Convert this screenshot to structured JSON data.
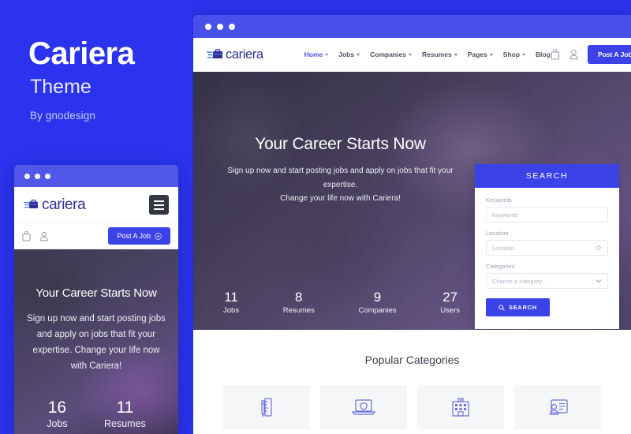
{
  "promo": {
    "title": "Cariera",
    "subtitle": "Theme",
    "byline": "By gnodesign",
    "background_color": "#2b33ee"
  },
  "mobile_mockup": {
    "chrome_dots": 3,
    "logo_text": "cariera",
    "menu_icon": "hamburger-icon",
    "toolbar_icons": [
      "bag-icon",
      "user-icon"
    ],
    "post_job_label": "Post A Job",
    "hero": {
      "title": "Your Career Starts Now",
      "subtitle": "Sign up now and start posting jobs and apply on jobs that fit your expertise. Change your life now with Cariera!",
      "stats": [
        {
          "value": "16",
          "label": "Jobs"
        },
        {
          "value": "11",
          "label": "Resumes"
        }
      ]
    }
  },
  "desktop_mockup": {
    "chrome_dots": 3,
    "logo_text": "cariera",
    "nav_items": [
      {
        "label": "Home",
        "has_caret": true,
        "active": true
      },
      {
        "label": "Jobs",
        "has_caret": true,
        "active": false
      },
      {
        "label": "Companies",
        "has_caret": true,
        "active": false
      },
      {
        "label": "Resumes",
        "has_caret": true,
        "active": false
      },
      {
        "label": "Pages",
        "has_caret": true,
        "active": false
      },
      {
        "label": "Shop",
        "has_caret": true,
        "active": false
      },
      {
        "label": "Blog",
        "has_caret": false,
        "active": false
      }
    ],
    "toolbar_icons": [
      "bag-icon",
      "user-icon"
    ],
    "post_job_label": "Post A Job",
    "hero": {
      "title": "Your Career Starts Now",
      "subtitle_line1": "Sign up now and start posting jobs and apply on jobs that fit your expertise.",
      "subtitle_line2": "Change your life now with Cariera!",
      "stats": [
        {
          "value": "11",
          "label": "Jobs"
        },
        {
          "value": "8",
          "label": "Resumes"
        },
        {
          "value": "9",
          "label": "Companies"
        },
        {
          "value": "27",
          "label": "Users"
        }
      ]
    },
    "search_panel": {
      "header": "SEARCH",
      "keywords_label": "Keywords",
      "keywords_placeholder": "Keywords",
      "location_label": "Location",
      "location_placeholder": "Location",
      "location_icon": "crosshair-icon",
      "categories_label": "Categories",
      "categories_placeholder": "Choose a category...",
      "categories_icon": "chevron-down-icon",
      "button_label": "SEARCH",
      "button_icon": "search-icon"
    },
    "categories_section": {
      "title": "Popular Categories",
      "cards": [
        {
          "icon": "ruler-pen-icon"
        },
        {
          "icon": "laptop-shield-icon"
        },
        {
          "icon": "building-icon"
        },
        {
          "icon": "resume-person-icon"
        }
      ]
    }
  },
  "colors": {
    "brand_blue": "#2b33ee",
    "button_blue": "#3b42e8",
    "logo_navy": "#2e3192",
    "icon_purple": "#6a70d8"
  }
}
